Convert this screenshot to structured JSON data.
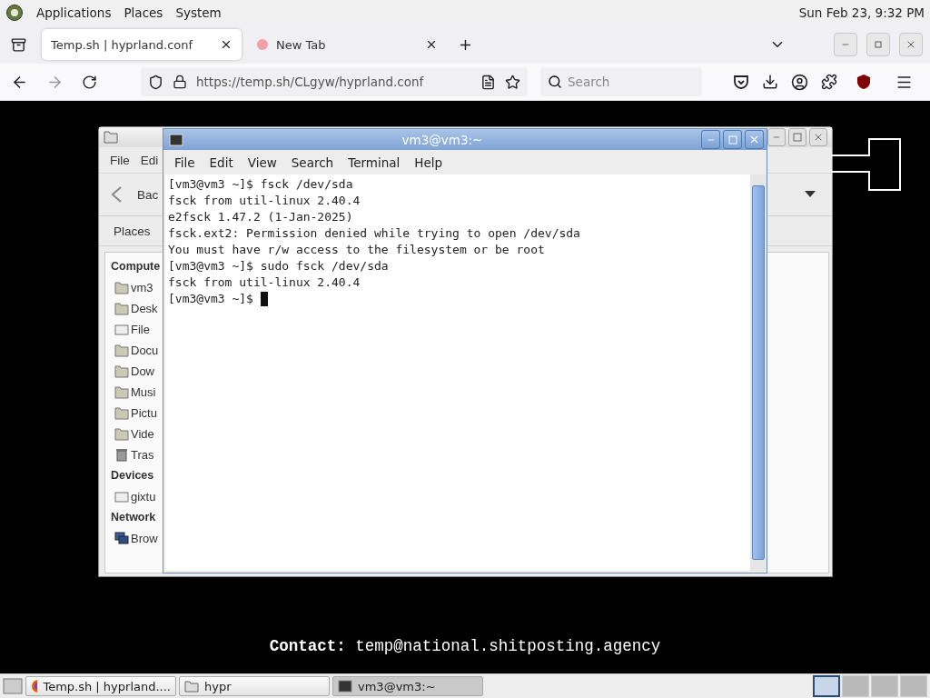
{
  "top_panel": {
    "menus": [
      "Applications",
      "Places",
      "System"
    ],
    "clock": "Sun Feb 23,  9:32 PM"
  },
  "browser": {
    "tabs": [
      {
        "label": "Temp.sh | hyprland.conf",
        "selected": true
      },
      {
        "label": "New Tab",
        "selected": false
      }
    ],
    "url": "https://temp.sh/CLgyw/hyprland.conf",
    "search": {
      "placeholder": "Search"
    }
  },
  "file_manager": {
    "menus": [
      "File",
      "Edi"
    ],
    "toolbar": [
      "Bac"
    ],
    "places_label": "Places",
    "sections": [
      {
        "heading": "Compute",
        "items": [
          {
            "label": "vm3",
            "kind": "home"
          },
          {
            "label": "Desk",
            "kind": "folder"
          },
          {
            "label": "File",
            "kind": "drive"
          },
          {
            "label": "Docu",
            "kind": "folder"
          },
          {
            "label": "Dow",
            "kind": "folder"
          },
          {
            "label": "Musi",
            "kind": "folder"
          },
          {
            "label": "Pictu",
            "kind": "folder"
          },
          {
            "label": "Vide",
            "kind": "folder"
          },
          {
            "label": "Tras",
            "kind": "trash"
          }
        ]
      },
      {
        "heading": "Devices",
        "items": [
          {
            "label": "gixtu",
            "kind": "drive"
          }
        ]
      },
      {
        "heading": "Network",
        "items": [
          {
            "label": "Brow",
            "kind": "network"
          }
        ]
      }
    ]
  },
  "terminal": {
    "title": "vm3@vm3:~",
    "menus": [
      "File",
      "Edit",
      "View",
      "Search",
      "Terminal",
      "Help"
    ],
    "lines": [
      "[vm3@vm3 ~]$ fsck /dev/sda",
      "fsck from util-linux 2.40.4",
      "e2fsck 1.47.2 (1-Jan-2025)",
      "fsck.ext2: Permission denied while trying to open /dev/sda",
      "You must have r/w access to the filesystem or be root",
      "[vm3@vm3 ~]$ sudo fsck /dev/sda",
      "fsck from util-linux 2.40.4",
      "[vm3@vm3 ~]$ "
    ]
  },
  "contact": {
    "label": "Contact:",
    "value": "temp@national.shitposting.agency"
  },
  "taskbar": {
    "items": [
      {
        "label": "Temp.sh | hyprland....",
        "kind": "browser",
        "selected": false
      },
      {
        "label": "hypr",
        "kind": "folder",
        "selected": false
      },
      {
        "label": "vm3@vm3:~",
        "kind": "terminal",
        "selected": true
      }
    ],
    "workspaces": [
      {
        "selected": true
      },
      {
        "selected": false
      },
      {
        "selected": false
      },
      {
        "selected": false
      }
    ]
  }
}
